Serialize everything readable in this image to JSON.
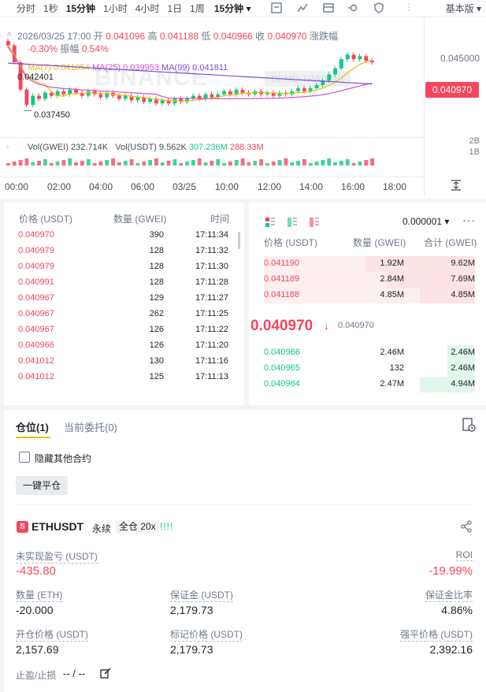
{
  "toolbar": {
    "intervals": [
      "分时",
      "1秒",
      "15分钟",
      "1小时",
      "4小时",
      "1日",
      "1周",
      "15分钟"
    ],
    "active_index": 2,
    "basic_label": "基本版",
    "overflow_label": "⋮"
  },
  "chart": {
    "ohlc": {
      "date": "2026/03/25 17:00",
      "open_label": "开",
      "open": "0.041096",
      "high_label": "高",
      "high": "0.041188",
      "low_label": "低",
      "low": "0.040966",
      "close_label": "收",
      "close": "0.040970",
      "change_label": "涨跌幅",
      "change": "-0.30%",
      "amp_label": "振幅",
      "amp": "0.54%"
    },
    "ma": {
      "ma7_label": "MA(7)",
      "ma7": "0.041054",
      "ma25_label": "MA(25)",
      "ma25": "0.039953",
      "ma99_label": "MA(99)",
      "ma99": "0.041811"
    },
    "high_marker": "0.042401",
    "low_marker": "0.037450",
    "watermark": "BINANCE",
    "demo_badge": "DEMO TRADING",
    "price_axis": [
      "0.045000"
    ],
    "last_price_tag": "0.040970",
    "vol_axis": [
      "2B",
      "1B"
    ],
    "vol": {
      "gwei_label": "Vol(GWEI)",
      "gwei": "232.714K",
      "usdt_label": "Vol(USDT)",
      "usdt": "9.562K",
      "teal": "307.236M",
      "pink": "288.33M"
    },
    "time_axis": [
      "00:00",
      "02:00",
      "04:00",
      "06:00",
      "03/25",
      "10:00",
      "12:00",
      "14:00",
      "16:00",
      "18:00"
    ]
  },
  "chart_data": {
    "type": "candlestick",
    "title": "",
    "y_range": [
      0.0365,
      0.0455
    ],
    "candles": [
      [
        0.0424,
        0.0421
      ],
      [
        0.0421,
        0.041
      ],
      [
        0.041,
        0.0392
      ],
      [
        0.0392,
        0.0382
      ],
      [
        0.0382,
        0.0388
      ],
      [
        0.0388,
        0.0386
      ],
      [
        0.0386,
        0.039
      ],
      [
        0.039,
        0.0388
      ],
      [
        0.0388,
        0.0391
      ],
      [
        0.0391,
        0.0389
      ],
      [
        0.0389,
        0.0392
      ],
      [
        0.0392,
        0.039
      ],
      [
        0.039,
        0.0388
      ],
      [
        0.0388,
        0.0391
      ],
      [
        0.0391,
        0.0389
      ],
      [
        0.0389,
        0.0387
      ],
      [
        0.0387,
        0.039
      ],
      [
        0.039,
        0.0388
      ],
      [
        0.0388,
        0.0386
      ],
      [
        0.0386,
        0.0388
      ],
      [
        0.0388,
        0.0385
      ],
      [
        0.0385,
        0.0387
      ],
      [
        0.0387,
        0.0384
      ],
      [
        0.0384,
        0.0386
      ],
      [
        0.0386,
        0.0383
      ],
      [
        0.0383,
        0.0385
      ],
      [
        0.0385,
        0.0383
      ],
      [
        0.0383,
        0.0386
      ],
      [
        0.0386,
        0.0384
      ],
      [
        0.0384,
        0.0386
      ],
      [
        0.0386,
        0.0388
      ],
      [
        0.0388,
        0.0386
      ],
      [
        0.0386,
        0.0389
      ],
      [
        0.0389,
        0.0387
      ],
      [
        0.0387,
        0.0389
      ],
      [
        0.0389,
        0.0391
      ],
      [
        0.0391,
        0.0389
      ],
      [
        0.0389,
        0.0392
      ],
      [
        0.0392,
        0.039
      ],
      [
        0.039,
        0.0389
      ],
      [
        0.0389,
        0.0391
      ],
      [
        0.0391,
        0.0389
      ],
      [
        0.0389,
        0.039
      ],
      [
        0.039,
        0.0388
      ],
      [
        0.0388,
        0.039
      ],
      [
        0.039,
        0.0389
      ],
      [
        0.0389,
        0.0391
      ],
      [
        0.0391,
        0.0393
      ],
      [
        0.0393,
        0.0391
      ],
      [
        0.0391,
        0.0393
      ],
      [
        0.0393,
        0.0395
      ],
      [
        0.0395,
        0.0398
      ],
      [
        0.0398,
        0.0402
      ],
      [
        0.0402,
        0.0406
      ],
      [
        0.0406,
        0.0412
      ],
      [
        0.0412,
        0.0415
      ],
      [
        0.0415,
        0.0412
      ],
      [
        0.0412,
        0.0414
      ],
      [
        0.0414,
        0.0411
      ],
      [
        0.0411,
        0.041
      ]
    ]
  },
  "trades": {
    "headers": [
      "价格 (USDT)",
      "数量 (GWEI)",
      "时间"
    ],
    "rows": [
      [
        "0.040970",
        "390",
        "17:11:34"
      ],
      [
        "0.040979",
        "128",
        "17:11:32"
      ],
      [
        "0.040979",
        "128",
        "17:11:30"
      ],
      [
        "0.040991",
        "128",
        "17:11:28"
      ],
      [
        "0.040967",
        "129",
        "17:11:27"
      ],
      [
        "0.040967",
        "262",
        "17:11:25"
      ],
      [
        "0.040967",
        "126",
        "17:11:22"
      ],
      [
        "0.040966",
        "126",
        "17:11:20"
      ],
      [
        "0.041012",
        "130",
        "17:11:16"
      ],
      [
        "0.041012",
        "125",
        "17:11:13"
      ]
    ]
  },
  "orderbook": {
    "tick": "0.000001",
    "headers": [
      "价格 (USDT)",
      "数量 (GWEI)",
      "合计 (GWEI)"
    ],
    "asks": [
      {
        "price": "0.041190",
        "qty": "1.92M",
        "sum": "9.62M",
        "depth": 1.0
      },
      {
        "price": "0.041189",
        "qty": "2.84M",
        "sum": "7.69M",
        "depth": 0.8
      },
      {
        "price": "0.041188",
        "qty": "4.85M",
        "sum": "4.85M",
        "depth": 0.5
      }
    ],
    "mid_price": "0.040970",
    "mid_mark": "0.040970",
    "bids": [
      {
        "price": "0.040966",
        "qty": "2.46M",
        "sum": "2.46M",
        "depth": 0.25
      },
      {
        "price": "0.040965",
        "qty": "132",
        "sum": "2.46M",
        "depth": 0.25
      },
      {
        "price": "0.040964",
        "qty": "2.47M",
        "sum": "4.94M",
        "depth": 0.5
      }
    ]
  },
  "positions": {
    "tabs": [
      "仓位(1)",
      "当前委托(0)"
    ],
    "hide_other": "隐藏其他合约",
    "close_all": "一键平仓",
    "item": {
      "badge": "S",
      "symbol": "ETHUSDT",
      "perp": "永续",
      "margin_mode": "全仓 20x",
      "leverage_bars": "!!!!",
      "unrealized_label": "未实现盈亏 (USDT)",
      "unrealized": "-435.80",
      "roi_label": "ROI",
      "roi": "-19.99%",
      "qty_label": "数量 (ETH)",
      "qty": "-20.000",
      "margin_label": "保证金 (USDT)",
      "margin": "2,179.73",
      "margin_ratio_label": "保证金比率",
      "margin_ratio": "4.86%",
      "entry_label": "开仓价格 (USDT)",
      "entry": "2,157.69",
      "mark_label": "标记价格 (USDT)",
      "mark": "2,179.73",
      "liq_label": "强平价格 (USDT)",
      "liq": "2,392.16",
      "tpsl_label": "止盈/止损",
      "tpsl": "-- / --"
    }
  },
  "colors": {
    "up": "#0ecb81",
    "down": "#f6465d",
    "accent": "#f0b90b"
  }
}
